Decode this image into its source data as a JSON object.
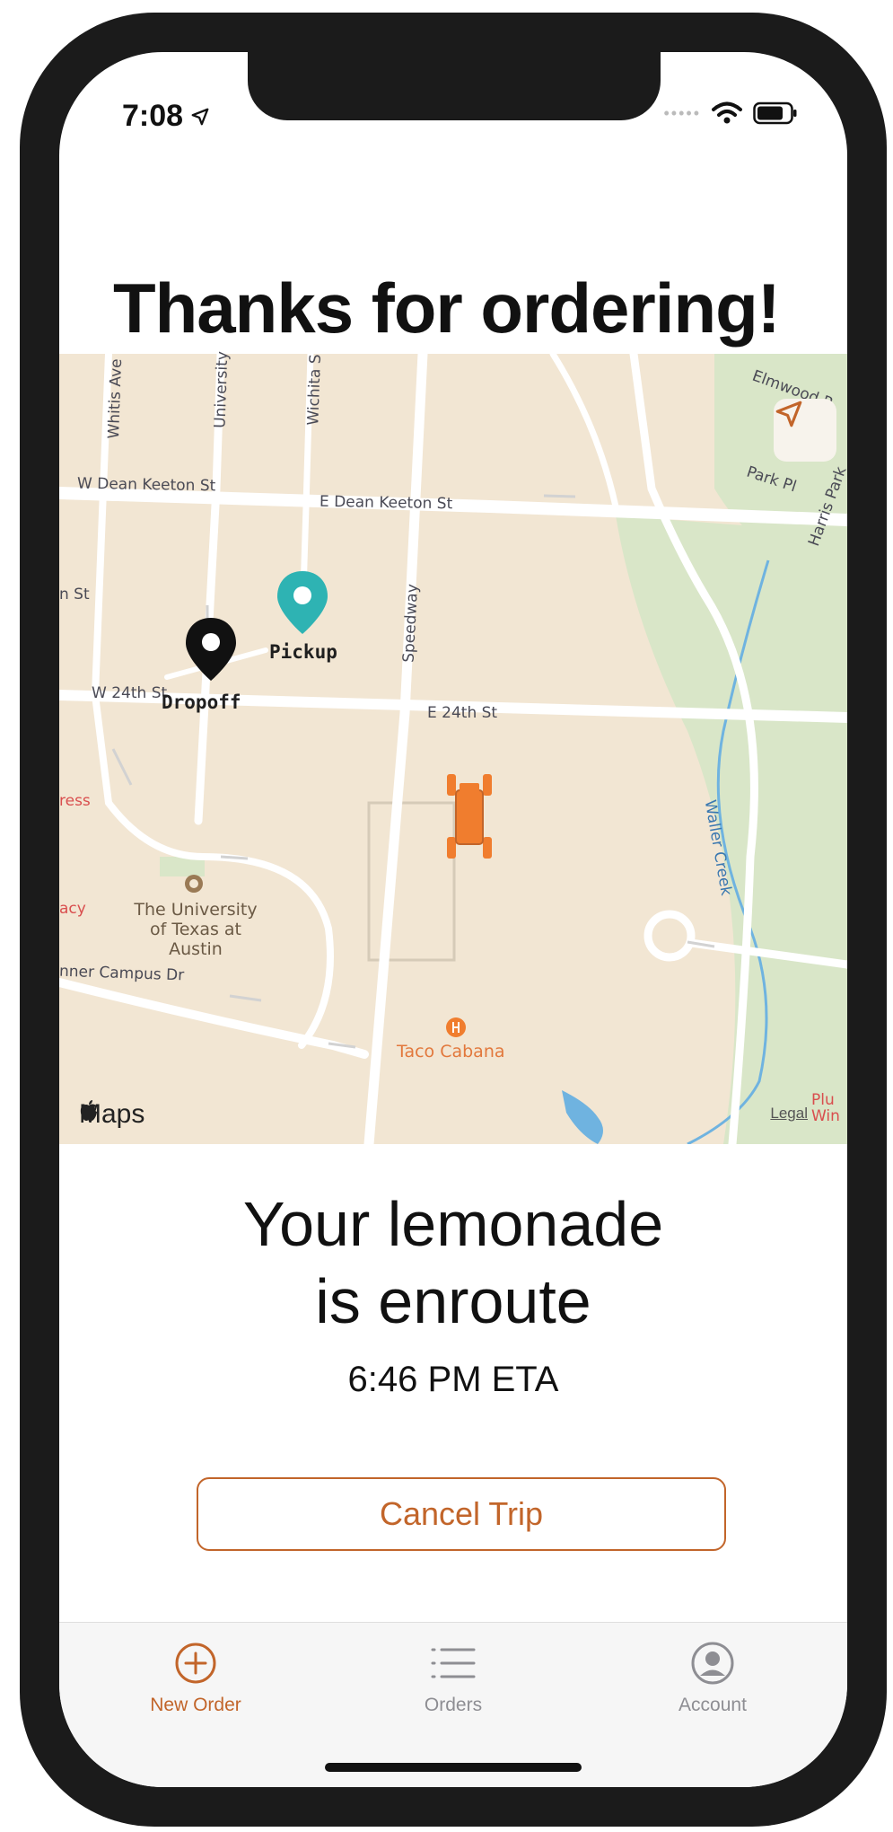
{
  "status_bar": {
    "time": "7:08"
  },
  "header": {
    "title": "Thanks for ordering!"
  },
  "map": {
    "streets": {
      "w_dean_keeton": "W Dean Keeton St",
      "e_dean_keeton": "E Dean Keeton St",
      "whitis": "Whitis Ave",
      "university": "University",
      "wichita": "Wichita S",
      "speedway": "Speedway",
      "w_24th": "W 24th St",
      "e_24th": "E 24th St",
      "st_left": "n St",
      "ress": "ress",
      "acy": "acy",
      "inner_campus": "nner Campus Dr",
      "waller_creek": "Waller Creek",
      "elmwood": "Elmwood P",
      "park_pl": "Park Pl",
      "harris": "Harris Park"
    },
    "pickup_label": "Pickup",
    "dropoff_label": "Dropoff",
    "poi_ut": [
      "The University",
      "of Texas at",
      "Austin"
    ],
    "poi_taco": "Taco Cabana",
    "attribution": "Maps",
    "legal": "Legal",
    "legal_extra": "Plu Win"
  },
  "status": {
    "line1": "Your lemonade",
    "line2": "is enroute",
    "eta": "6:46 PM ETA"
  },
  "actions": {
    "cancel": "Cancel Trip"
  },
  "tabs": [
    {
      "label": "New Order",
      "icon": "plus-circle-icon",
      "active": true
    },
    {
      "label": "Orders",
      "icon": "list-icon",
      "active": false
    },
    {
      "label": "Account",
      "icon": "person-circle-icon",
      "active": false
    }
  ],
  "colors": {
    "accent": "#c2652a",
    "pickup_pin": "#2eb3b3",
    "map_bg": "#f2e6d3",
    "park": "#d9e6c8",
    "water": "#6fb3e0",
    "vehicle": "#f07d2e"
  }
}
